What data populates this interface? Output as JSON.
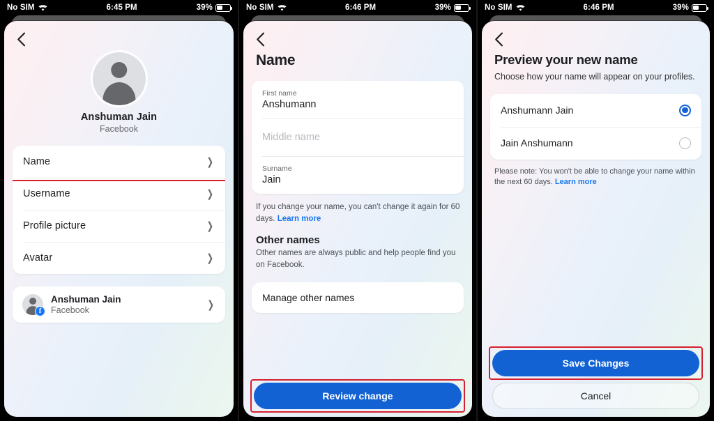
{
  "screens": [
    {
      "status": {
        "carrier": "No SIM",
        "time": "6:45 PM",
        "battery": "39%"
      },
      "back_icon": "chevron-left-icon",
      "profile": {
        "name": "Anshuman Jain",
        "subtitle": "Facebook"
      },
      "list": [
        {
          "label": "Name",
          "highlighted": true
        },
        {
          "label": "Username",
          "highlighted": false
        },
        {
          "label": "Profile picture",
          "highlighted": false
        },
        {
          "label": "Avatar",
          "highlighted": false
        }
      ],
      "account": {
        "name": "Anshuman Jain",
        "subtitle": "Facebook",
        "badge": "f"
      }
    },
    {
      "status": {
        "carrier": "No SIM",
        "time": "6:46 PM",
        "battery": "39%"
      },
      "title": "Name",
      "fields": [
        {
          "label": "First name",
          "value": "Anshumann",
          "placeholder": ""
        },
        {
          "label": "",
          "value": "",
          "placeholder": "Middle name"
        },
        {
          "label": "Surname",
          "value": "Jain",
          "placeholder": ""
        }
      ],
      "note_text": "If you change your name, you can't change it again for 60 days. ",
      "note_link": "Learn more",
      "section_heading": "Other names",
      "section_text": "Other names are always public and help people find you on Facebook.",
      "manage_label": "Manage other names",
      "primary_button": "Review change"
    },
    {
      "status": {
        "carrier": "No SIM",
        "time": "6:46 PM",
        "battery": "39%"
      },
      "title": "Preview your new name",
      "subtitle": "Choose how your name will appear on your profiles.",
      "options": [
        {
          "label": "Anshumann Jain",
          "selected": true
        },
        {
          "label": "Jain Anshumann",
          "selected": false
        }
      ],
      "note_text": "Please note: You won't be able to change your name within the next 60 days. ",
      "note_link": "Learn more",
      "primary_button": "Save Changes",
      "secondary_button": "Cancel"
    }
  ],
  "colors": {
    "accent_blue": "#1262d4",
    "link_blue": "#1877f2",
    "highlight_red": "#d62030",
    "facebook_blue": "#1877f2"
  }
}
